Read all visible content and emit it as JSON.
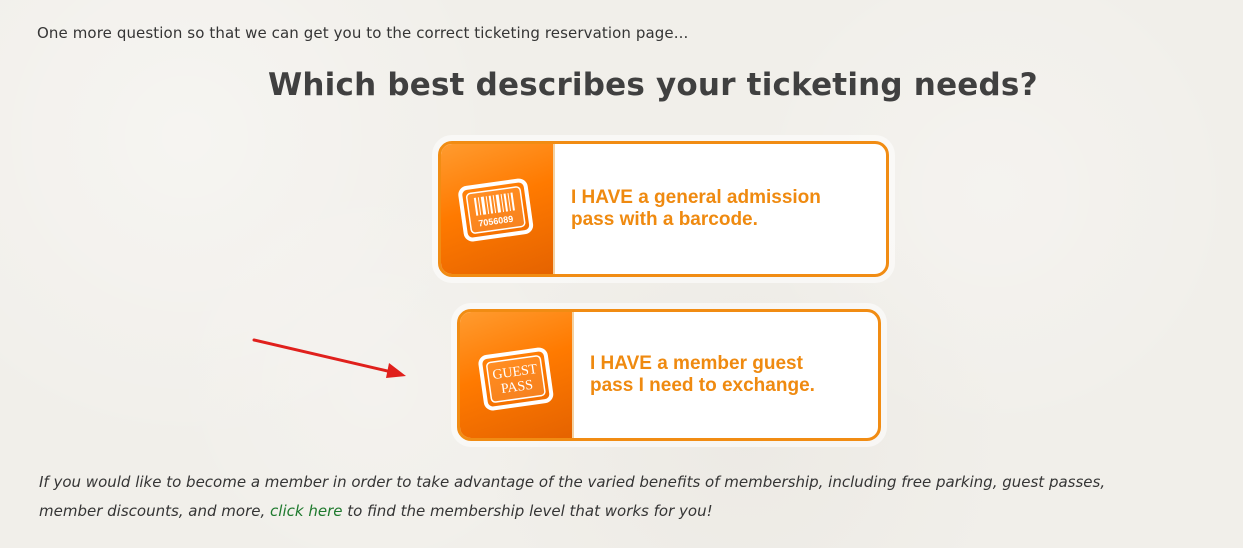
{
  "page": {
    "intro_text": "One more question so that we can get you to the correct ticketing reservation page...",
    "headline": "Which best describes your ticketing needs?"
  },
  "options": [
    {
      "title_line_1": "I HAVE  a general admission",
      "title_line_2": "pass with a barcode.",
      "ticket_number": "7056089"
    },
    {
      "title_line_1": "I HAVE a member guest",
      "title_line_2": "pass I need to exchange.",
      "guest_pass_line_1": "GUEST",
      "guest_pass_line_2": "PASS"
    }
  ],
  "footer": {
    "text_before_link": "If you would like to become a member in order to take advantage of the varied benefits of membership, including free parking, guest passes,",
    "text_line_2_before_link": "member discounts, and more,",
    "link_label": "click here",
    "text_after_link": "to find the membership level that works for you!"
  },
  "colors": {
    "accent": "#f18c13",
    "link": "#1f7a2e",
    "annotation_arrow": "#e0201c"
  },
  "icons": {
    "barcode_ticket": "barcode-ticket-icon",
    "guest_pass": "guest-pass-icon",
    "annotation_arrow": "red-arrow-icon"
  }
}
